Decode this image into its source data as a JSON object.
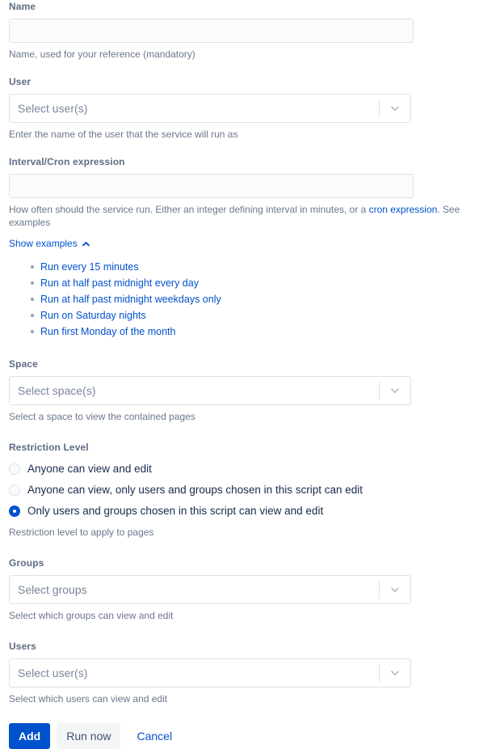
{
  "fields": {
    "name": {
      "label": "Name",
      "value": "",
      "placeholder": "",
      "help": "Name, used for your reference (mandatory)"
    },
    "user": {
      "label": "User",
      "placeholder": "Select user(s)",
      "help": "Enter the name of the user that the service will run as"
    },
    "interval": {
      "label": "Interval/Cron expression",
      "value": "",
      "placeholder": "",
      "help_before_link": "How often should the service run. Either an integer defining interval in minutes, or a ",
      "help_link": "cron expression",
      "help_after_link": ". See examples",
      "toggle_label": "Show examples",
      "toggle_icon": "chevron-up-icon",
      "examples": [
        "Run every 15 minutes",
        "Run at half past midnight every day",
        "Run at half past midnight weekdays only",
        "Run on Saturday nights",
        "Run first Monday of the month"
      ]
    },
    "space": {
      "label": "Space",
      "placeholder": "Select space(s)",
      "help": "Select a space to view the contained pages"
    },
    "restriction": {
      "label": "Restriction Level",
      "help": "Restriction level to apply to pages",
      "options": [
        {
          "label": "Anyone can view and edit",
          "selected": false
        },
        {
          "label": "Anyone can view, only users and groups chosen in this script can edit",
          "selected": false
        },
        {
          "label": "Only users and groups chosen in this script can view and edit",
          "selected": true
        }
      ]
    },
    "groups": {
      "label": "Groups",
      "placeholder": "Select groups",
      "help": "Select which groups can view and edit"
    },
    "users": {
      "label": "Users",
      "placeholder": "Select user(s)",
      "help": "Select which users can view and edit"
    }
  },
  "footer": {
    "add_label": "Add",
    "run_now_label": "Run now",
    "cancel_label": "Cancel"
  },
  "icons": {
    "dropdown": "chevron-down-icon"
  },
  "colors": {
    "accent": "#0052cc",
    "label": "#5e6c84",
    "help": "#6b778c",
    "input_bg": "#fafbfc",
    "border": "#dfe1e6",
    "text": "#172b4d"
  }
}
